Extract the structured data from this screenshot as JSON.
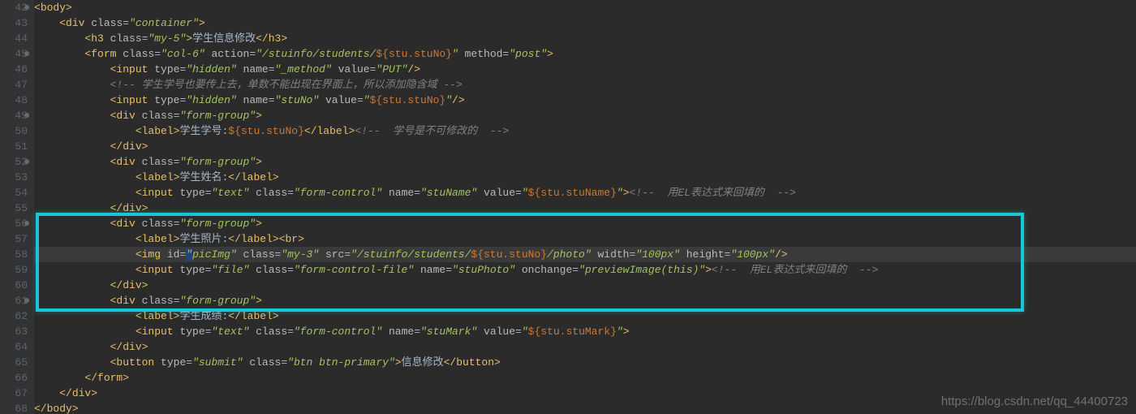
{
  "watermark": "https://blog.csdn.net/qq_44400723",
  "lines": [
    {
      "n": 42,
      "fold": true,
      "tokens": [
        {
          "w": "<",
          "t": "t"
        },
        {
          "w": "body",
          "t": "t"
        },
        {
          "w": ">",
          "t": "t"
        }
      ]
    },
    {
      "n": 43,
      "tokens": [
        {
          "w": "    <",
          "t": "t"
        },
        {
          "w": "div",
          "t": "t"
        },
        {
          "w": " ",
          "t": "w"
        },
        {
          "w": "class",
          "t": "a"
        },
        {
          "w": "=",
          "t": "w"
        },
        {
          "w": "\"container\"",
          "t": "s"
        },
        {
          "w": ">",
          "t": "t"
        }
      ]
    },
    {
      "n": 44,
      "tokens": [
        {
          "w": "        <",
          "t": "t"
        },
        {
          "w": "h3",
          "t": "t"
        },
        {
          "w": " ",
          "t": "w"
        },
        {
          "w": "class",
          "t": "a"
        },
        {
          "w": "=",
          "t": "w"
        },
        {
          "w": "\"my-5\"",
          "t": "s"
        },
        {
          "w": ">",
          "t": "t"
        },
        {
          "w": "学生信息修改",
          "t": "w"
        },
        {
          "w": "</",
          "t": "t"
        },
        {
          "w": "h3",
          "t": "t"
        },
        {
          "w": ">",
          "t": "t"
        }
      ]
    },
    {
      "n": 45,
      "fold": true,
      "tokens": [
        {
          "w": "        <",
          "t": "t"
        },
        {
          "w": "form",
          "t": "t"
        },
        {
          "w": " ",
          "t": "w"
        },
        {
          "w": "class",
          "t": "a"
        },
        {
          "w": "=",
          "t": "w"
        },
        {
          "w": "\"col-6\"",
          "t": "s"
        },
        {
          "w": " ",
          "t": "w"
        },
        {
          "w": "action",
          "t": "a"
        },
        {
          "w": "=",
          "t": "w"
        },
        {
          "w": "\"/stuinfo/students/",
          "t": "s"
        },
        {
          "w": "${stu.stuNo}",
          "t": "o"
        },
        {
          "w": "\"",
          "t": "s"
        },
        {
          "w": " ",
          "t": "w"
        },
        {
          "w": "method",
          "t": "a"
        },
        {
          "w": "=",
          "t": "w"
        },
        {
          "w": "\"post\"",
          "t": "s"
        },
        {
          "w": ">",
          "t": "t"
        }
      ]
    },
    {
      "n": 46,
      "tokens": [
        {
          "w": "            <",
          "t": "t"
        },
        {
          "w": "input",
          "t": "t"
        },
        {
          "w": " ",
          "t": "w"
        },
        {
          "w": "type",
          "t": "a"
        },
        {
          "w": "=",
          "t": "w"
        },
        {
          "w": "\"hidden\"",
          "t": "s"
        },
        {
          "w": " ",
          "t": "w"
        },
        {
          "w": "name",
          "t": "a"
        },
        {
          "w": "=",
          "t": "w"
        },
        {
          "w": "\"_method\"",
          "t": "s"
        },
        {
          "w": " ",
          "t": "w"
        },
        {
          "w": "value",
          "t": "a"
        },
        {
          "w": "=",
          "t": "w"
        },
        {
          "w": "\"PUT\"",
          "t": "s"
        },
        {
          "w": "/>",
          "t": "t"
        }
      ]
    },
    {
      "n": 47,
      "tokens": [
        {
          "w": "            ",
          "t": "w"
        },
        {
          "w": "<!-- 学生学号也要传上去，单数不能出现在界面上，所以添加隐含域 -->",
          "t": "c"
        }
      ]
    },
    {
      "n": 48,
      "tokens": [
        {
          "w": "            <",
          "t": "t"
        },
        {
          "w": "input",
          "t": "t"
        },
        {
          "w": " ",
          "t": "w"
        },
        {
          "w": "type",
          "t": "a"
        },
        {
          "w": "=",
          "t": "w"
        },
        {
          "w": "\"hidden\"",
          "t": "s"
        },
        {
          "w": " ",
          "t": "w"
        },
        {
          "w": "name",
          "t": "a"
        },
        {
          "w": "=",
          "t": "w"
        },
        {
          "w": "\"stuNo\"",
          "t": "s"
        },
        {
          "w": " ",
          "t": "w"
        },
        {
          "w": "value",
          "t": "a"
        },
        {
          "w": "=",
          "t": "w"
        },
        {
          "w": "\"",
          "t": "s"
        },
        {
          "w": "${stu.stuNo}",
          "t": "o"
        },
        {
          "w": "\"",
          "t": "s"
        },
        {
          "w": "/>",
          "t": "t"
        }
      ]
    },
    {
      "n": 49,
      "fold": true,
      "tokens": [
        {
          "w": "            <",
          "t": "t"
        },
        {
          "w": "div",
          "t": "t"
        },
        {
          "w": " ",
          "t": "w"
        },
        {
          "w": "class",
          "t": "a"
        },
        {
          "w": "=",
          "t": "w"
        },
        {
          "w": "\"form-group\"",
          "t": "s"
        },
        {
          "w": ">",
          "t": "t"
        }
      ]
    },
    {
      "n": 50,
      "tokens": [
        {
          "w": "                <",
          "t": "t"
        },
        {
          "w": "label",
          "t": "t"
        },
        {
          "w": ">",
          "t": "t"
        },
        {
          "w": "学生学号:",
          "t": "w"
        },
        {
          "w": "${stu.stuNo}",
          "t": "o"
        },
        {
          "w": "</",
          "t": "t"
        },
        {
          "w": "label",
          "t": "t"
        },
        {
          "w": ">",
          "t": "t"
        },
        {
          "w": "<!--  学号是不可修改的  -->",
          "t": "c"
        }
      ]
    },
    {
      "n": 51,
      "tokens": [
        {
          "w": "            </",
          "t": "t"
        },
        {
          "w": "div",
          "t": "t"
        },
        {
          "w": ">",
          "t": "t"
        }
      ]
    },
    {
      "n": 52,
      "fold": true,
      "tokens": [
        {
          "w": "            <",
          "t": "t"
        },
        {
          "w": "div",
          "t": "t"
        },
        {
          "w": " ",
          "t": "w"
        },
        {
          "w": "class",
          "t": "a"
        },
        {
          "w": "=",
          "t": "w"
        },
        {
          "w": "\"form-group\"",
          "t": "s"
        },
        {
          "w": ">",
          "t": "t"
        }
      ]
    },
    {
      "n": 53,
      "tokens": [
        {
          "w": "                <",
          "t": "t"
        },
        {
          "w": "label",
          "t": "t"
        },
        {
          "w": ">",
          "t": "t"
        },
        {
          "w": "学生姓名:",
          "t": "w"
        },
        {
          "w": "</",
          "t": "t"
        },
        {
          "w": "label",
          "t": "t"
        },
        {
          "w": ">",
          "t": "t"
        }
      ]
    },
    {
      "n": 54,
      "tokens": [
        {
          "w": "                <",
          "t": "t"
        },
        {
          "w": "input",
          "t": "t"
        },
        {
          "w": " ",
          "t": "w"
        },
        {
          "w": "type",
          "t": "a"
        },
        {
          "w": "=",
          "t": "w"
        },
        {
          "w": "\"text\"",
          "t": "s"
        },
        {
          "w": " ",
          "t": "w"
        },
        {
          "w": "class",
          "t": "a"
        },
        {
          "w": "=",
          "t": "w"
        },
        {
          "w": "\"form-control\"",
          "t": "s"
        },
        {
          "w": " ",
          "t": "w"
        },
        {
          "w": "name",
          "t": "a"
        },
        {
          "w": "=",
          "t": "w"
        },
        {
          "w": "\"stuName\"",
          "t": "s"
        },
        {
          "w": " ",
          "t": "w"
        },
        {
          "w": "value",
          "t": "a"
        },
        {
          "w": "=",
          "t": "w"
        },
        {
          "w": "\"",
          "t": "s"
        },
        {
          "w": "${stu.stuName}",
          "t": "o"
        },
        {
          "w": "\"",
          "t": "s"
        },
        {
          "w": ">",
          "t": "t"
        },
        {
          "w": "<!--  用EL表达式来回填的  -->",
          "t": "c"
        }
      ]
    },
    {
      "n": 55,
      "tokens": [
        {
          "w": "            </",
          "t": "t"
        },
        {
          "w": "div",
          "t": "t"
        },
        {
          "w": ">",
          "t": "t"
        }
      ]
    },
    {
      "n": 56,
      "fold": true,
      "tokens": [
        {
          "w": "            <",
          "t": "t"
        },
        {
          "w": "div",
          "t": "t"
        },
        {
          "w": " ",
          "t": "w"
        },
        {
          "w": "class",
          "t": "a"
        },
        {
          "w": "=",
          "t": "w"
        },
        {
          "w": "\"form-group\"",
          "t": "s"
        },
        {
          "w": ">",
          "t": "t"
        }
      ]
    },
    {
      "n": 57,
      "tokens": [
        {
          "w": "                <",
          "t": "t"
        },
        {
          "w": "label",
          "t": "t"
        },
        {
          "w": ">",
          "t": "t"
        },
        {
          "w": "学生照片:",
          "t": "w"
        },
        {
          "w": "</",
          "t": "t"
        },
        {
          "w": "label",
          "t": "t"
        },
        {
          "w": "><",
          "t": "t"
        },
        {
          "w": "br",
          "t": "t"
        },
        {
          "w": ">",
          "t": "t"
        }
      ]
    },
    {
      "n": 58,
      "hi": true,
      "tokens": [
        {
          "w": "                <",
          "t": "t"
        },
        {
          "w": "img",
          "t": "t"
        },
        {
          "w": " ",
          "t": "w"
        },
        {
          "w": "id",
          "t": "a"
        },
        {
          "w": "=",
          "t": "w"
        },
        {
          "w": "\"",
          "t": "s",
          "hl": true
        },
        {
          "w": "picImg\"",
          "t": "s"
        },
        {
          "w": " ",
          "t": "w"
        },
        {
          "w": "class",
          "t": "a"
        },
        {
          "w": "=",
          "t": "w"
        },
        {
          "w": "\"my-3\"",
          "t": "s"
        },
        {
          "w": " ",
          "t": "w"
        },
        {
          "w": "src",
          "t": "a"
        },
        {
          "w": "=",
          "t": "w"
        },
        {
          "w": "\"/stuinfo/students/",
          "t": "s"
        },
        {
          "w": "${stu.stuNo}",
          "t": "o"
        },
        {
          "w": "/photo",
          "t": "s"
        },
        {
          "w": "\"",
          "t": "s"
        },
        {
          "w": " ",
          "t": "w"
        },
        {
          "w": "width",
          "t": "a"
        },
        {
          "w": "=",
          "t": "w"
        },
        {
          "w": "\"100px\"",
          "t": "s"
        },
        {
          "w": " ",
          "t": "w"
        },
        {
          "w": "height",
          "t": "a"
        },
        {
          "w": "=",
          "t": "w"
        },
        {
          "w": "\"100px\"",
          "t": "s"
        },
        {
          "w": "/>",
          "t": "t"
        }
      ]
    },
    {
      "n": 59,
      "tokens": [
        {
          "w": "                <",
          "t": "t"
        },
        {
          "w": "input",
          "t": "t"
        },
        {
          "w": " ",
          "t": "w"
        },
        {
          "w": "type",
          "t": "a"
        },
        {
          "w": "=",
          "t": "w"
        },
        {
          "w": "\"file\"",
          "t": "s"
        },
        {
          "w": " ",
          "t": "w"
        },
        {
          "w": "class",
          "t": "a"
        },
        {
          "w": "=",
          "t": "w"
        },
        {
          "w": "\"form-control-file\"",
          "t": "s"
        },
        {
          "w": " ",
          "t": "w"
        },
        {
          "w": "name",
          "t": "a"
        },
        {
          "w": "=",
          "t": "w"
        },
        {
          "w": "\"stuPhoto\"",
          "t": "s"
        },
        {
          "w": " ",
          "t": "w"
        },
        {
          "w": "onchange",
          "t": "a"
        },
        {
          "w": "=",
          "t": "w"
        },
        {
          "w": "\"previewImage(this)\"",
          "t": "s"
        },
        {
          "w": ">",
          "t": "t"
        },
        {
          "w": "<!--  用EL表达式来回填的  -->",
          "t": "c"
        }
      ]
    },
    {
      "n": 60,
      "tokens": [
        {
          "w": "            </",
          "t": "t"
        },
        {
          "w": "div",
          "t": "t"
        },
        {
          "w": ">",
          "t": "t"
        }
      ]
    },
    {
      "n": 61,
      "fold": true,
      "tokens": [
        {
          "w": "            <",
          "t": "t"
        },
        {
          "w": "div",
          "t": "t"
        },
        {
          "w": " ",
          "t": "w"
        },
        {
          "w": "class",
          "t": "a"
        },
        {
          "w": "=",
          "t": "w"
        },
        {
          "w": "\"form-group\"",
          "t": "s"
        },
        {
          "w": ">",
          "t": "t"
        }
      ]
    },
    {
      "n": 62,
      "tokens": [
        {
          "w": "                <",
          "t": "t"
        },
        {
          "w": "label",
          "t": "t"
        },
        {
          "w": ">",
          "t": "t"
        },
        {
          "w": "学生成绩:",
          "t": "w"
        },
        {
          "w": "</",
          "t": "t"
        },
        {
          "w": "label",
          "t": "t"
        },
        {
          "w": ">",
          "t": "t"
        }
      ]
    },
    {
      "n": 63,
      "tokens": [
        {
          "w": "                <",
          "t": "t"
        },
        {
          "w": "input",
          "t": "t"
        },
        {
          "w": " ",
          "t": "w"
        },
        {
          "w": "type",
          "t": "a"
        },
        {
          "w": "=",
          "t": "w"
        },
        {
          "w": "\"text\"",
          "t": "s"
        },
        {
          "w": " ",
          "t": "w"
        },
        {
          "w": "class",
          "t": "a"
        },
        {
          "w": "=",
          "t": "w"
        },
        {
          "w": "\"form-control\"",
          "t": "s"
        },
        {
          "w": " ",
          "t": "w"
        },
        {
          "w": "name",
          "t": "a"
        },
        {
          "w": "=",
          "t": "w"
        },
        {
          "w": "\"stuMark\"",
          "t": "s"
        },
        {
          "w": " ",
          "t": "w"
        },
        {
          "w": "value",
          "t": "a"
        },
        {
          "w": "=",
          "t": "w"
        },
        {
          "w": "\"",
          "t": "s"
        },
        {
          "w": "${stu.stuMark}",
          "t": "o"
        },
        {
          "w": "\"",
          "t": "s"
        },
        {
          "w": ">",
          "t": "t"
        }
      ]
    },
    {
      "n": 64,
      "tokens": [
        {
          "w": "            </",
          "t": "t"
        },
        {
          "w": "div",
          "t": "t"
        },
        {
          "w": ">",
          "t": "t"
        }
      ]
    },
    {
      "n": 65,
      "tokens": [
        {
          "w": "            <",
          "t": "t"
        },
        {
          "w": "button",
          "t": "t"
        },
        {
          "w": " ",
          "t": "w"
        },
        {
          "w": "type",
          "t": "a"
        },
        {
          "w": "=",
          "t": "w"
        },
        {
          "w": "\"submit\"",
          "t": "s"
        },
        {
          "w": " ",
          "t": "w"
        },
        {
          "w": "class",
          "t": "a"
        },
        {
          "w": "=",
          "t": "w"
        },
        {
          "w": "\"btn btn-primary\"",
          "t": "s"
        },
        {
          "w": ">",
          "t": "t"
        },
        {
          "w": "信息修改",
          "t": "w"
        },
        {
          "w": "</",
          "t": "t"
        },
        {
          "w": "button",
          "t": "t"
        },
        {
          "w": ">",
          "t": "t"
        }
      ]
    },
    {
      "n": 66,
      "tokens": [
        {
          "w": "        </",
          "t": "t"
        },
        {
          "w": "form",
          "t": "t"
        },
        {
          "w": ">",
          "t": "t"
        }
      ]
    },
    {
      "n": 67,
      "tokens": [
        {
          "w": "    </",
          "t": "t"
        },
        {
          "w": "div",
          "t": "t"
        },
        {
          "w": ">",
          "t": "t"
        }
      ]
    },
    {
      "n": 68,
      "tokens": [
        {
          "w": "</",
          "t": "t"
        },
        {
          "w": "body",
          "t": "t"
        },
        {
          "w": ">",
          "t": "t"
        }
      ]
    }
  ]
}
